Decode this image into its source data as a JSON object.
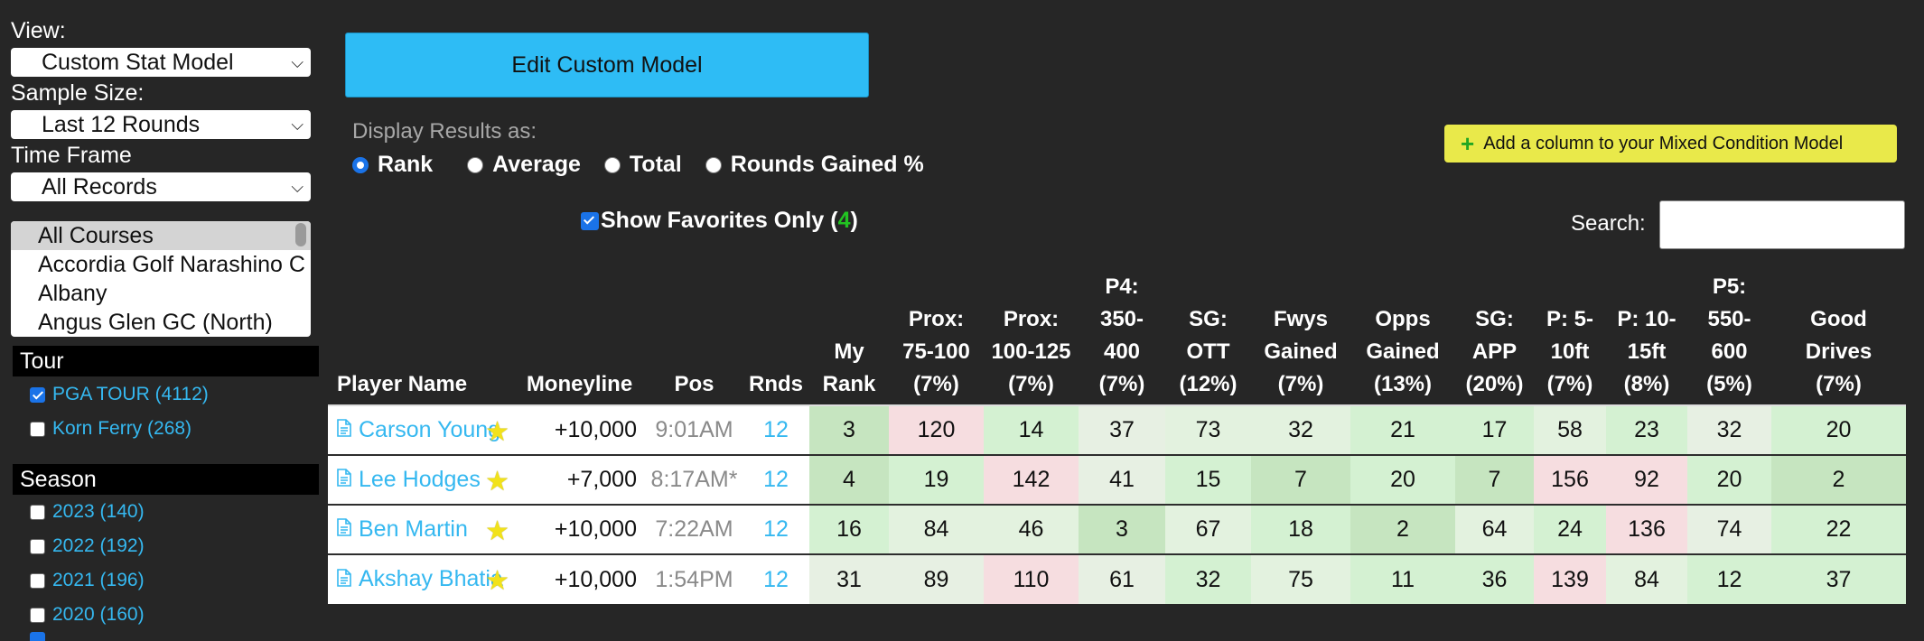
{
  "sidebar": {
    "view_label": "View:",
    "view_value": "Custom Stat Model",
    "sample_label": "Sample Size:",
    "sample_value": "Last 12 Rounds",
    "timeframe_label": "Time Frame",
    "timeframe_value": "All Records",
    "courses": [
      "All Courses",
      "Accordia Golf Narashino C",
      "Albany",
      "Angus Glen GC (North)"
    ],
    "tour_header": "Tour",
    "tours": [
      {
        "label": "PGA TOUR (4112)",
        "checked": true
      },
      {
        "label": "Korn Ferry (268)",
        "checked": false
      }
    ],
    "season_header": "Season",
    "seasons": [
      {
        "label": "2023 (140)",
        "checked": false
      },
      {
        "label": "2022 (192)",
        "checked": false
      },
      {
        "label": "2021 (196)",
        "checked": false
      },
      {
        "label": "2020 (160)",
        "checked": false
      }
    ]
  },
  "controls": {
    "edit_button": "Edit Custom Model",
    "display_label": "Display Results as:",
    "radios": [
      "Rank",
      "Average",
      "Total",
      "Rounds Gained %"
    ],
    "radio_selected": "Rank",
    "favorites_label": "Show Favorites Only (",
    "favorites_count": "4",
    "favorites_close": ")",
    "add_column_button": "Add a column to your Mixed Condition Model",
    "search_label": "Search:",
    "search_value": ""
  },
  "table": {
    "headers": {
      "player": "Player Name",
      "moneyline": "Moneyline",
      "pos": "Pos",
      "rnds": "Rnds",
      "stats": [
        [
          "My",
          "Rank"
        ],
        [
          "Prox:",
          "75-100",
          "(7%)"
        ],
        [
          "Prox:",
          "100-125",
          "(7%)"
        ],
        [
          "P4:",
          "350-",
          "400",
          "(7%)"
        ],
        [
          "SG:",
          "OTT",
          "(12%)"
        ],
        [
          "Fwys",
          "Gained",
          "(7%)"
        ],
        [
          "Opps",
          "Gained",
          "(13%)"
        ],
        [
          "SG:",
          "APP",
          "(20%)"
        ],
        [
          "P: 5-",
          "10ft",
          "(7%)"
        ],
        [
          "P: 10-",
          "15ft",
          "(8%)"
        ],
        [
          "P5:",
          "550-",
          "600",
          "(5%)"
        ],
        [
          "Good",
          "Drives",
          "(7%)"
        ]
      ]
    },
    "rows": [
      {
        "name": "Carson Young",
        "moneyline": "+10,000",
        "pos": "9:01AM",
        "rnds": "12",
        "stats": [
          "3",
          "120",
          "14",
          "37",
          "73",
          "32",
          "21",
          "17",
          "58",
          "23",
          "32",
          "20"
        ]
      },
      {
        "name": "Lee Hodges",
        "moneyline": "+7,000",
        "pos": "8:17AM*",
        "rnds": "12",
        "stats": [
          "4",
          "19",
          "142",
          "41",
          "15",
          "7",
          "20",
          "7",
          "156",
          "92",
          "20",
          "2"
        ]
      },
      {
        "name": "Ben Martin",
        "moneyline": "+10,000",
        "pos": "7:22AM",
        "rnds": "12",
        "stats": [
          "16",
          "84",
          "46",
          "3",
          "67",
          "18",
          "2",
          "64",
          "24",
          "136",
          "74",
          "22"
        ]
      },
      {
        "name": "Akshay Bhatia",
        "moneyline": "+10,000",
        "pos": "1:54PM",
        "rnds": "12",
        "stats": [
          "31",
          "89",
          "110",
          "61",
          "32",
          "75",
          "11",
          "36",
          "139",
          "84",
          "12",
          "37"
        ]
      }
    ]
  },
  "colors": {
    "accent_blue": "#2ebcf5",
    "link_blue": "#35b8f0",
    "add_button_yellow": "#e9e94a",
    "favorites_count_green": "#22c322",
    "rank_good_green": "#c6e5c0",
    "rank_bad_red": "#f6dde0"
  }
}
